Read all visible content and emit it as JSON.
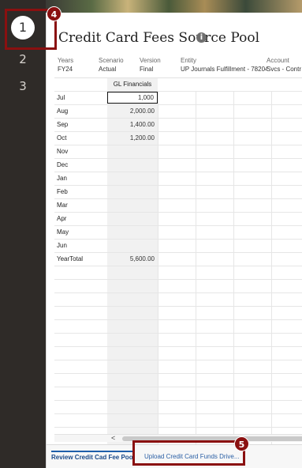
{
  "steps": [
    "1",
    "2",
    "3"
  ],
  "page_title": "Credit Card Fees Source Pool",
  "info_icon": "info-icon",
  "pov": {
    "years": {
      "label": "Years",
      "value": "FY24"
    },
    "scenario": {
      "label": "Scenario",
      "value": "Actual"
    },
    "version": {
      "label": "Version",
      "value": "Final"
    },
    "entity": {
      "label": "Entity",
      "value": "UP Journals Fulfillment - 78204"
    },
    "account": {
      "label": "Account",
      "value": "Svcs - Contr"
    }
  },
  "grid": {
    "column_header": "GL Financials",
    "rows": [
      {
        "label": "Jul",
        "value": "1,000"
      },
      {
        "label": "Aug",
        "value": "2,000.00"
      },
      {
        "label": "Sep",
        "value": "1,400.00"
      },
      {
        "label": "Oct",
        "value": "1,200.00"
      },
      {
        "label": "Nov",
        "value": ""
      },
      {
        "label": "Dec",
        "value": ""
      },
      {
        "label": "Jan",
        "value": ""
      },
      {
        "label": "Feb",
        "value": ""
      },
      {
        "label": "Mar",
        "value": ""
      },
      {
        "label": "Apr",
        "value": ""
      },
      {
        "label": "May",
        "value": ""
      },
      {
        "label": "Jun",
        "value": ""
      },
      {
        "label": "YearTotal",
        "value": "5,600.00"
      }
    ]
  },
  "scroll_arrow": "<",
  "tabs": [
    {
      "label": "Review Credit Cad Fee Poo",
      "active": true
    },
    {
      "label": "Upload Credit Card Funds Drive...",
      "active": false
    }
  ],
  "callouts": [
    "4",
    "5"
  ],
  "colors": {
    "rail": "#2f2b28",
    "callout": "#8a1010",
    "tab_active": "#1a4a8a"
  }
}
